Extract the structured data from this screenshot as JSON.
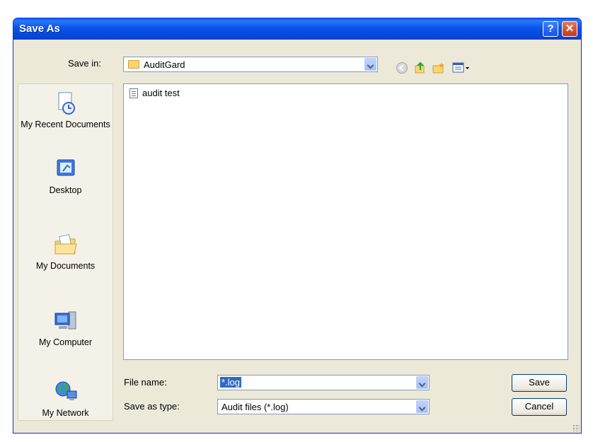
{
  "window": {
    "title": "Save As"
  },
  "save_in": {
    "label": "Save in:",
    "value": "AuditGard"
  },
  "places": [
    {
      "label": "My Recent Documents",
      "icon": "recent-documents-icon"
    },
    {
      "label": "Desktop",
      "icon": "desktop-icon"
    },
    {
      "label": "My Documents",
      "icon": "my-documents-icon"
    },
    {
      "label": "My Computer",
      "icon": "my-computer-icon"
    },
    {
      "label": "My Network",
      "icon": "my-network-icon"
    }
  ],
  "files": [
    {
      "name": "audit test",
      "icon": "text-file-icon"
    }
  ],
  "file_name": {
    "label": "File name:",
    "value": "*.log"
  },
  "save_as_type": {
    "label": "Save as type:",
    "value": "Audit files (*.log)"
  },
  "buttons": {
    "save": "Save",
    "cancel": "Cancel"
  },
  "title_buttons": {
    "help": "?",
    "close": "✕"
  }
}
